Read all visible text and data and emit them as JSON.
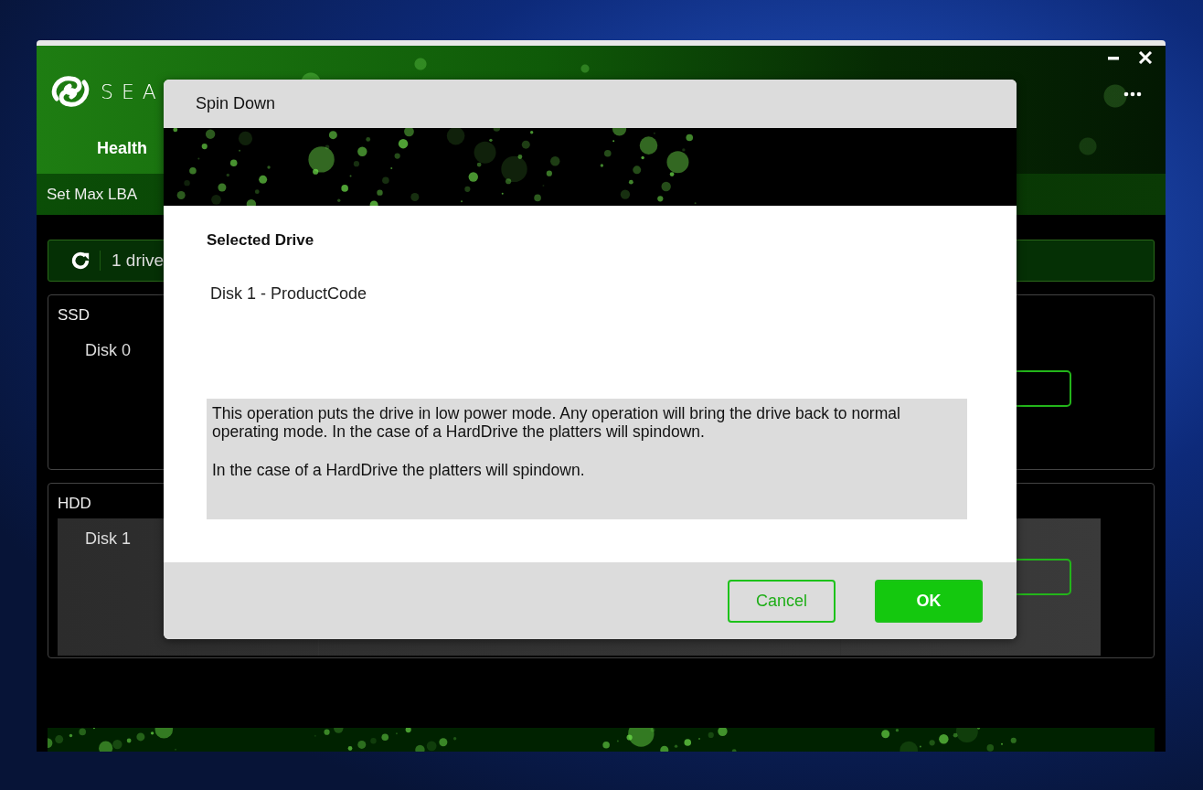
{
  "app": {
    "brand": "SEA",
    "nav_tabs": [
      {
        "label": "Health",
        "selected": true
      }
    ],
    "sub_tabs": [
      {
        "label": "Set Max LBA"
      }
    ],
    "drive_toolbar": {
      "count": "1 drive"
    },
    "sections": [
      {
        "label": "SSD",
        "disks": [
          {
            "name": "Disk 0",
            "selected": false
          }
        ]
      },
      {
        "label": "HDD",
        "disks": [
          {
            "name": "Disk 1",
            "selected": true
          }
        ]
      }
    ]
  },
  "dialog": {
    "title": "Spin Down",
    "selected_label": "Selected Drive",
    "selected_drive": "Disk 1 - ProductCode",
    "description": [
      "This operation puts the drive in low power mode. Any operation will bring the drive back to normal operating mode. In the case of a HardDrive the platters will spindown.",
      "In the case of a HardDrive the platters will spindown."
    ],
    "buttons": [
      {
        "label": "Cancel",
        "kind": "secondary"
      },
      {
        "label": "OK",
        "kind": "primary"
      }
    ]
  }
}
